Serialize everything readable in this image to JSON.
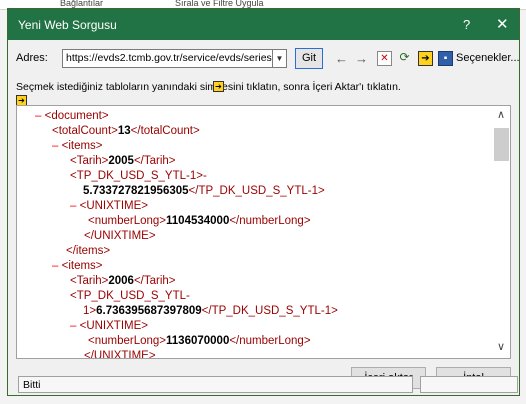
{
  "background": {
    "left_tab": "Bağlantılar",
    "right_tab": "Sırala ve Filtre Uygula"
  },
  "dialog": {
    "title": "Yeni Web Sorgusu",
    "help": "?",
    "close": "✕",
    "title_bar_color": "#217346"
  },
  "address": {
    "label": "Adres:",
    "value": "https://evds2.tcmb.gov.tr/service/evds/series-",
    "go_button": "Git",
    "options_button": "Seçenekler..."
  },
  "instruction": "Seçmek istediğiniz tabloların yanındaki  simgesini tıklatın, sonra İçeri Aktar'ı tıklatın.",
  "xml_lines": [
    {
      "minus": "–",
      "open": "<document>",
      "value": "",
      "close": ""
    },
    {
      "minus": "",
      "open": "<totalCount>",
      "value": "13",
      "close": "</totalCount>"
    },
    {
      "minus": "–",
      "open": "<items>",
      "value": "",
      "close": ""
    },
    {
      "minus": "",
      "open": "<Tarih>",
      "value": "2005",
      "close": "</Tarih>"
    },
    {
      "minus": "",
      "open": "<TP_DK_USD_S_YTL-1>-",
      "value": "",
      "close": ""
    },
    {
      "minus": "",
      "open": "",
      "value": "5.733727821956305",
      "close": "</TP_DK_USD_S_YTL-1>"
    },
    {
      "minus": "–",
      "open": "<UNIXTIME>",
      "value": "",
      "close": ""
    },
    {
      "minus": "",
      "open": "<numberLong>",
      "value": "1104534000",
      "close": "</numberLong>"
    },
    {
      "minus": "",
      "open": "</UNIXTIME>",
      "value": "",
      "close": ""
    },
    {
      "minus": "",
      "open": "</items>",
      "value": "",
      "close": ""
    },
    {
      "minus": "–",
      "open": "<items>",
      "value": "",
      "close": ""
    },
    {
      "minus": "",
      "open": "<Tarih>",
      "value": "2006",
      "close": "</Tarih>"
    },
    {
      "minus": "",
      "open": "<TP_DK_USD_S_YTL-",
      "value": "",
      "close": ""
    },
    {
      "minus": "",
      "open": "1>",
      "value": "6.736395687397809",
      "close": "</TP_DK_USD_S_YTL-1>"
    },
    {
      "minus": "–",
      "open": "<UNIXTIME>",
      "value": "",
      "close": ""
    },
    {
      "minus": "",
      "open": "<numberLong>",
      "value": "1136070000",
      "close": "</numberLong>"
    },
    {
      "minus": "",
      "open": "</UNIXTIME>",
      "value": "",
      "close": ""
    }
  ],
  "buttons": {
    "import": "İçeri aktar",
    "cancel": "İptal"
  },
  "status": "Bitti"
}
